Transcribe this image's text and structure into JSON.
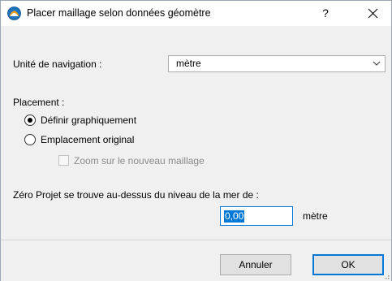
{
  "window": {
    "title": "Placer maillage selon données géomètre",
    "help_label": "?"
  },
  "navigation": {
    "label": "Unité de navigation :",
    "selected_value": "mètre"
  },
  "placement": {
    "label": "Placement :",
    "option_graphical": "Définir graphiquement",
    "option_original": "Emplacement original",
    "selected": "graphical",
    "zoom_checkbox_label": "Zoom sur le nouveau maillage",
    "zoom_checked": false,
    "zoom_enabled": false
  },
  "elevation": {
    "label": "Zéro Projet se trouve au-dessus du niveau de la mer de :",
    "value": "0,00",
    "unit": "mètre"
  },
  "buttons": {
    "cancel": "Annuler",
    "ok": "OK"
  },
  "colors": {
    "accent": "#0078d7",
    "app_icon_blue": "#1e73be",
    "app_icon_orange": "#f39c12"
  }
}
